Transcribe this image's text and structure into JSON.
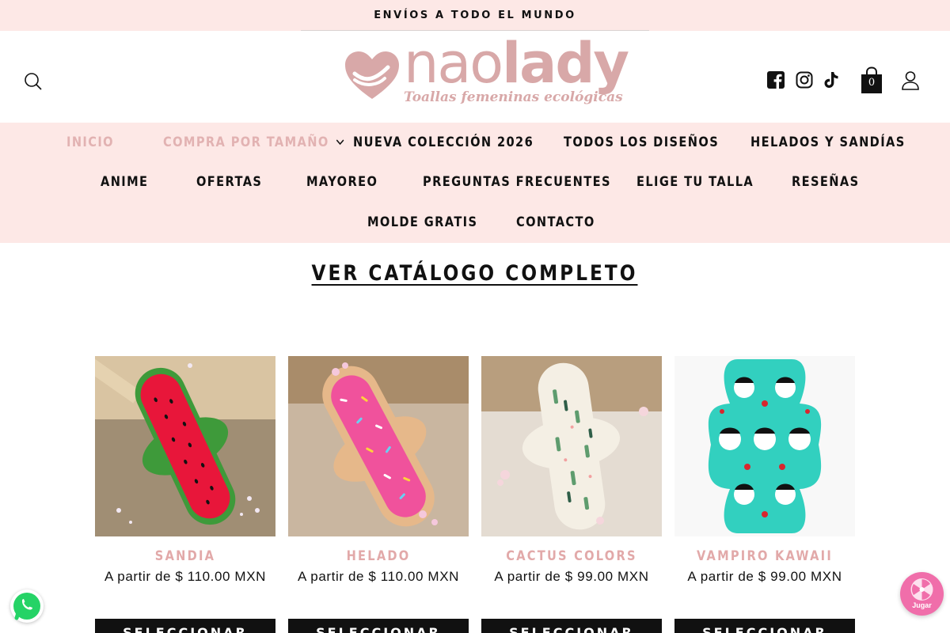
{
  "announcement": "ENVÍOS A TODO EL MUNDO",
  "brand": {
    "name_light": "nao",
    "name_bold": "lady",
    "tagline": "Toallas femeninas ecológicas",
    "color": "#d8a8a8"
  },
  "header": {
    "cart_count": "0",
    "icons": [
      "search-icon",
      "facebook-icon",
      "instagram-icon",
      "tiktok-icon",
      "cart-icon",
      "user-icon"
    ]
  },
  "nav": {
    "items": [
      {
        "label": "INICIO"
      },
      {
        "label": "COMPRA POR TAMAÑO"
      },
      {
        "label": "NUEVA COLECCIÓN 2026"
      },
      {
        "label": "TODOS LOS DISEÑOS"
      },
      {
        "label": "HELADOS Y SANDÍAS"
      },
      {
        "label": "ANIME"
      },
      {
        "label": "OFERTAS"
      },
      {
        "label": "MAYOREO"
      },
      {
        "label": "PREGUNTAS FRECUENTES"
      },
      {
        "label": "ELIGE TU TALLA"
      },
      {
        "label": "RESEÑAS"
      },
      {
        "label": "MOLDE GRATIS"
      },
      {
        "label": "CONTACTO"
      }
    ]
  },
  "catalog_link": "VER CATÁLOGO COMPLETO",
  "products": [
    {
      "name": "SANDIA",
      "price": "A partir de $ 110.00 MXN",
      "button": "SELECCIONAR"
    },
    {
      "name": "HELADO",
      "price": "A partir de $ 110.00 MXN",
      "button": "SELECCIONAR"
    },
    {
      "name": "CACTUS COLORS",
      "price": "A partir de $ 99.00 MXN",
      "button": "SELECCIONAR"
    },
    {
      "name": "VAMPIRO KAWAII",
      "price": "A partir de $ 99.00 MXN",
      "button": "SELECCIONAR"
    }
  ],
  "widgets": {
    "game_label": "Jugar"
  },
  "colors": {
    "accent_pink": "#fde8e6",
    "product_name": "#e2a9a9",
    "nav_muted": "#e2b2b2",
    "button": "#111111"
  }
}
